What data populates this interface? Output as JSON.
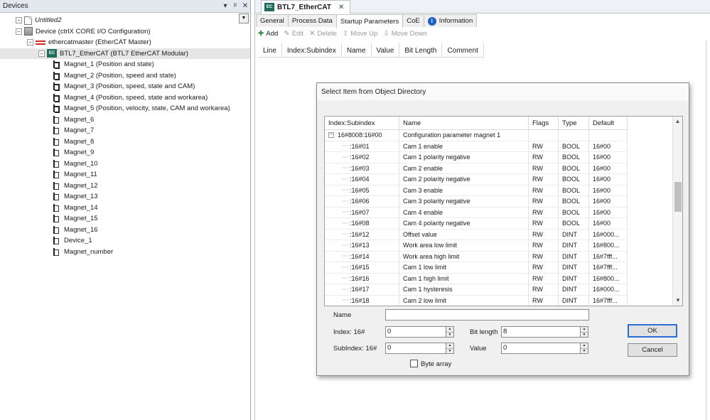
{
  "devices_pane": {
    "title": "Devices",
    "pin_glyph": "▾",
    "autohide_glyph": "ᵖ",
    "close_glyph": "✕",
    "tree": [
      {
        "label": "Untitled2",
        "icon": "project-file-icon",
        "level": 0,
        "expander": "⊟",
        "italic": true
      },
      {
        "label": "Device (ctrlX CORE I/O Configuration)",
        "icon": "device-icon",
        "level": 1,
        "expander": "⊟"
      },
      {
        "label": "ethercatmaster (EtherCAT Master)",
        "icon": "ethercat-master-icon",
        "level": 2,
        "expander": "⊟"
      },
      {
        "label": "BTL7_EtherCAT (BTL7 EtherCAT Modular)",
        "icon": "ethercat-slave-icon",
        "level": 3,
        "expander": "⊟",
        "selected": true
      },
      {
        "label": "Magnet_1 (Position and state)",
        "icon": "module-icon",
        "level": 4
      },
      {
        "label": "Magnet_2 (Position, speed and state)",
        "icon": "module-icon",
        "level": 4
      },
      {
        "label": "Magnet_3 (Position, speed, state and CAM)",
        "icon": "module-icon",
        "level": 4
      },
      {
        "label": "Magnet_4 (Position, speed, state and workarea)",
        "icon": "module-icon",
        "level": 4
      },
      {
        "label": "Magnet_5 (Position, velocity, state, CAM and workarea)",
        "icon": "module-icon",
        "level": 4
      },
      {
        "label": "Magnet_6",
        "icon": "empty-slot-icon",
        "level": 4
      },
      {
        "label": "Magnet_7",
        "icon": "empty-slot-icon",
        "level": 4
      },
      {
        "label": "Magnet_8",
        "icon": "empty-slot-icon",
        "level": 4
      },
      {
        "label": "Magnet_9",
        "icon": "empty-slot-icon",
        "level": 4
      },
      {
        "label": "Magnet_10",
        "icon": "empty-slot-icon",
        "level": 4
      },
      {
        "label": "Magnet_11",
        "icon": "empty-slot-icon",
        "level": 4
      },
      {
        "label": "Magnet_12",
        "icon": "empty-slot-icon",
        "level": 4
      },
      {
        "label": "Magnet_13",
        "icon": "empty-slot-icon",
        "level": 4
      },
      {
        "label": "Magnet_14",
        "icon": "empty-slot-icon",
        "level": 4
      },
      {
        "label": "Magnet_15",
        "icon": "empty-slot-icon",
        "level": 4
      },
      {
        "label": "Magnet_16",
        "icon": "empty-slot-icon",
        "level": 4
      },
      {
        "label": "Device_1",
        "icon": "empty-slot-icon",
        "level": 4
      },
      {
        "label": "Magnet_number",
        "icon": "empty-slot-icon",
        "level": 4
      }
    ]
  },
  "editor": {
    "doc_tab": {
      "label": "BTL7_EtherCAT",
      "icon_text": "EC",
      "close": "✕"
    },
    "tabs": [
      {
        "label": "General",
        "active": false
      },
      {
        "label": "Process Data",
        "active": false
      },
      {
        "label": "Startup Parameters",
        "active": true
      },
      {
        "label": "CoE",
        "active": false
      },
      {
        "label": "Information",
        "active": false,
        "info": true
      }
    ],
    "info_glyph": "i",
    "toolbar": [
      {
        "label": "Add",
        "icon": "✚",
        "enabled": true,
        "name": "add-button",
        "icon_name": "add-icon"
      },
      {
        "label": "Edit",
        "icon": "✎",
        "enabled": false,
        "name": "edit-button",
        "icon_name": "edit-icon"
      },
      {
        "label": "Delete",
        "icon": "✕",
        "enabled": false,
        "name": "delete-button",
        "icon_name": "delete-icon"
      },
      {
        "label": "Move Up",
        "icon": "⇧",
        "enabled": false,
        "name": "move-up-button",
        "icon_name": "arrow-up-icon"
      },
      {
        "label": "Move Down",
        "icon": "⇩",
        "enabled": false,
        "name": "move-down-button",
        "icon_name": "arrow-down-icon"
      }
    ],
    "columns": [
      "Line",
      "Index:Subindex",
      "Name",
      "Value",
      "Bit Length",
      "Comment"
    ]
  },
  "dialog": {
    "title": "Select Item from Object Directory",
    "columns": [
      "Index:Subindex",
      "Name",
      "Flags",
      "Type",
      "Default"
    ],
    "group": {
      "index": "16#8008:16#00",
      "name": "Configuration parameter magnet 1",
      "expander": "⊟"
    },
    "rows": [
      {
        "index": ":16#01",
        "name": "Cam 1 enable",
        "flags": "RW",
        "type": "BOOL",
        "default": "16#00"
      },
      {
        "index": ":16#02",
        "name": "Cam 1 polarity negative",
        "flags": "RW",
        "type": "BOOL",
        "default": "16#00"
      },
      {
        "index": ":16#03",
        "name": "Cam 2 enable",
        "flags": "RW",
        "type": "BOOL",
        "default": "16#00"
      },
      {
        "index": ":16#04",
        "name": "Cam 2 polarity negative",
        "flags": "RW",
        "type": "BOOL",
        "default": "16#00"
      },
      {
        "index": ":16#05",
        "name": "Cam 3 enable",
        "flags": "RW",
        "type": "BOOL",
        "default": "16#00"
      },
      {
        "index": ":16#06",
        "name": "Cam 3 polarity negative",
        "flags": "RW",
        "type": "BOOL",
        "default": "16#00"
      },
      {
        "index": ":16#07",
        "name": "Cam 4 enable",
        "flags": "RW",
        "type": "BOOL",
        "default": "16#00"
      },
      {
        "index": ":16#08",
        "name": "Cam 4 polarity negative",
        "flags": "RW",
        "type": "BOOL",
        "default": "16#00"
      },
      {
        "index": ":16#12",
        "name": "Offset value",
        "flags": "RW",
        "type": "DINT",
        "default": "16#000..."
      },
      {
        "index": ":16#13",
        "name": "Work area low limit",
        "flags": "RW",
        "type": "DINT",
        "default": "16#800..."
      },
      {
        "index": ":16#14",
        "name": "Work area high limit",
        "flags": "RW",
        "type": "DINT",
        "default": "16#7fff..."
      },
      {
        "index": ":16#15",
        "name": "Cam 1 low limit",
        "flags": "RW",
        "type": "DINT",
        "default": "16#7fff..."
      },
      {
        "index": ":16#16",
        "name": "Cam 1 high limit",
        "flags": "RW",
        "type": "DINT",
        "default": "16#800..."
      },
      {
        "index": ":16#17",
        "name": "Cam 1 hysteresis",
        "flags": "RW",
        "type": "DINT",
        "default": "16#000..."
      },
      {
        "index": ":16#18",
        "name": "Cam 2 low limit",
        "flags": "RW",
        "type": "DINT",
        "default": "16#7fff..."
      }
    ],
    "tree_glyph": "⋯",
    "scroll_up": "▲",
    "scroll_down": "▼",
    "spin_up": "▲",
    "spin_down": "▼",
    "fields": {
      "name_label": "Name",
      "name_value": "",
      "index_label": "Index:  16#",
      "index_value": "0",
      "subindex_label": "SubIndex:  16#",
      "subindex_value": "0",
      "bitlength_label": "Bit length",
      "bitlength_value": "8",
      "value_label": "Value",
      "value_value": "0",
      "byte_array_label": "Byte array",
      "byte_array_checked": false
    },
    "ok_label": "OK",
    "cancel_label": "Cancel"
  },
  "colors": {
    "selected_row": "#e6e6e6",
    "default_button_border": "#2a6fd6",
    "master_icon": "#cc2a2a",
    "ethercat_icon": "#1e6d5e"
  }
}
